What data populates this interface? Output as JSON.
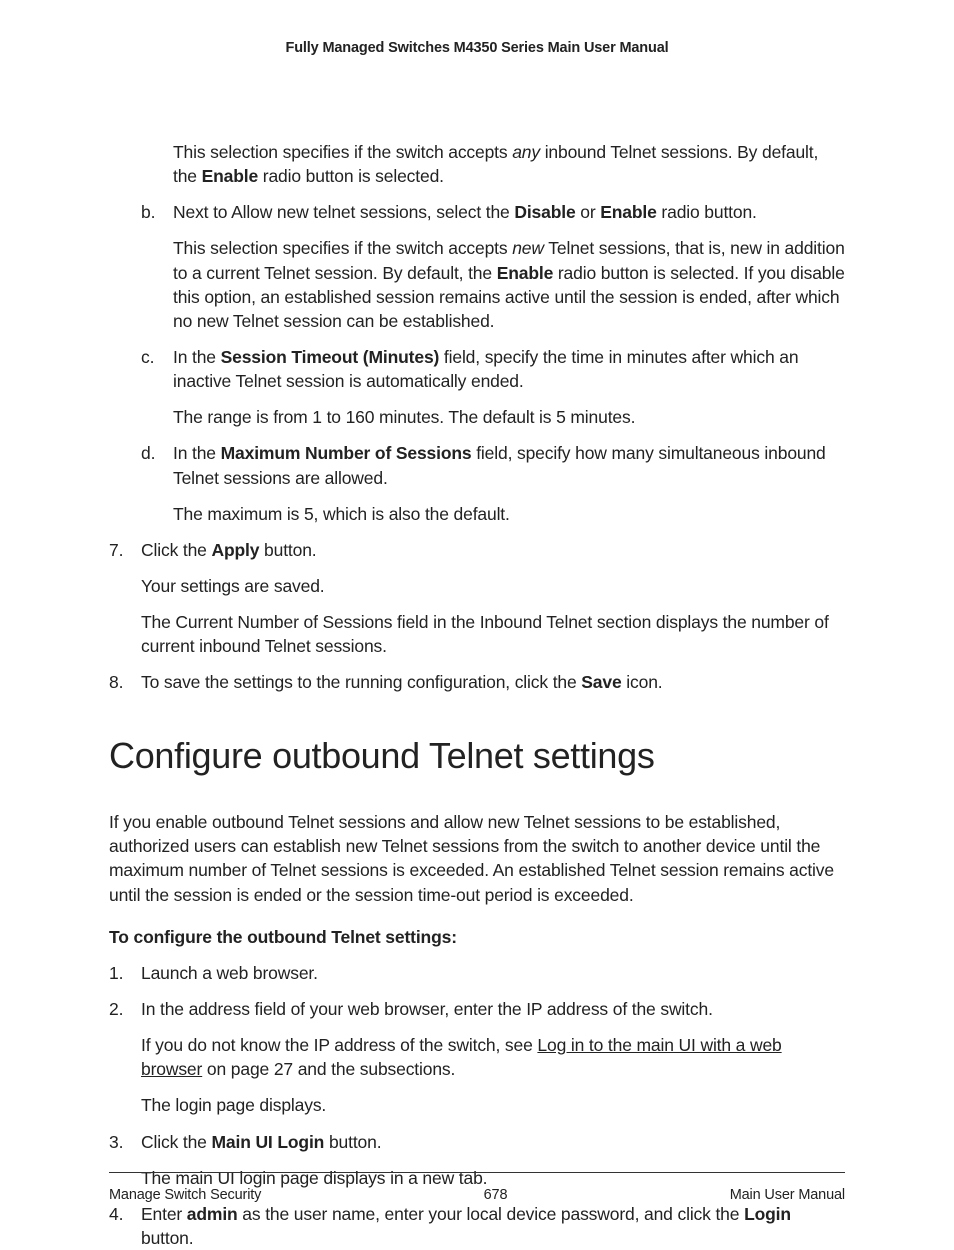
{
  "header": {
    "title": "Fully Managed Switches M4350 Series Main User Manual"
  },
  "content": {
    "lead_para": {
      "pre_italic": "This selection specifies if the switch accepts ",
      "italic": "any",
      "post_italic": " inbound Telnet sessions. By default, the ",
      "bold1": "Enable",
      "after_bold1": " radio button is selected."
    },
    "b": {
      "marker": "b.",
      "line1_pre": "Next to Allow new telnet sessions, select the ",
      "b_disable": "Disable",
      "or": " or ",
      "b_enable": "Enable",
      "line1_post": " radio button.",
      "p2_pre_italic": "This selection specifies if the switch accepts ",
      "p2_italic": "new",
      "p2_after_italic": " Telnet sessions, that is, new in addition to a current Telnet session. By default, the ",
      "p2_bold": "Enable",
      "p2_after_bold": " radio button is selected. If you disable this option, an established session remains active until the session is ended, after which no new Telnet session can be established."
    },
    "c": {
      "marker": "c.",
      "pre_bold": "In the ",
      "bold": "Session Timeout (Minutes)",
      "after_bold": " field, specify the time in minutes after which an inactive Telnet session is automatically ended.",
      "p2": "The range is from 1 to 160 minutes. The default is 5 minutes."
    },
    "d": {
      "marker": "d.",
      "pre_bold": "In the ",
      "bold": "Maximum Number of Sessions",
      "after_bold": " field, specify how many simultaneous inbound Telnet sessions are allowed.",
      "p2": "The maximum is 5, which is also the default."
    },
    "s7": {
      "marker": "7.",
      "pre_bold": "Click the ",
      "bold": "Apply",
      "after_bold": " button.",
      "p2": "Your settings are saved.",
      "p3": "The Current Number of Sessions field in the Inbound Telnet section displays the number of current inbound Telnet sessions."
    },
    "s8": {
      "marker": "8.",
      "pre_bold": "To save the settings to the running configuration, click the ",
      "bold": "Save",
      "after_bold": " icon."
    },
    "section_heading": "Configure outbound Telnet settings",
    "section_intro": "If you enable outbound Telnet sessions and allow new Telnet sessions to be established, authorized users can establish new Telnet sessions from the switch to another device until the maximum number of Telnet sessions is exceeded. An established Telnet session remains active until the session is ended or the session time-out period is exceeded.",
    "procedure_heading": "To configure the outbound Telnet settings:",
    "p1": {
      "marker": "1.",
      "text": "Launch a web browser."
    },
    "p2": {
      "marker": "2.",
      "text": "In the address field of your web browser, enter the IP address of the switch.",
      "p2_pre_link": "If you do not know the IP address of the switch, see ",
      "p2_link": "Log in to the main UI with a web browser",
      "p2_after_link": " on page 27 and the subsections.",
      "p3": "The login page displays."
    },
    "p3": {
      "marker": "3.",
      "pre_bold": "Click the ",
      "bold": "Main UI Login",
      "after_bold": " button.",
      "p2": "The main UI login page displays in a new tab."
    },
    "p4": {
      "marker": "4.",
      "pre_bold1": "Enter ",
      "bold1": "admin",
      "mid": " as the user name, enter your local device password, and click the ",
      "bold2": "Login",
      "after_bold2": " button."
    }
  },
  "footer": {
    "left": "Manage Switch Security",
    "center": "678",
    "right": "Main User Manual"
  }
}
